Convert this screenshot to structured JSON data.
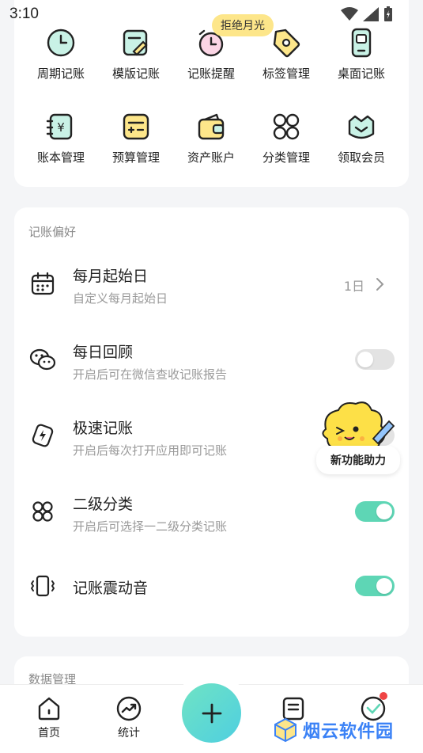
{
  "status": {
    "time": "3:10"
  },
  "tools": {
    "tip": "拒绝月光",
    "items": [
      {
        "label": "周期记账",
        "icon": "clock-icon"
      },
      {
        "label": "模版记账",
        "icon": "template-edit-icon"
      },
      {
        "label": "记账提醒",
        "icon": "alarm-clock-icon"
      },
      {
        "label": "标签管理",
        "icon": "tag-icon"
      },
      {
        "label": "桌面记账",
        "icon": "phone-widget-icon"
      },
      {
        "label": "账本管理",
        "icon": "ledger-icon"
      },
      {
        "label": "预算管理",
        "icon": "budget-calculator-icon"
      },
      {
        "label": "资产账户",
        "icon": "wallet-icon"
      },
      {
        "label": "分类管理",
        "icon": "category-grid-icon"
      },
      {
        "label": "领取会员",
        "icon": "vip-gem-icon"
      }
    ]
  },
  "prefs": {
    "title": "记账偏好",
    "rows": [
      {
        "title": "每月起始日",
        "subtitle": "自定义每月起始日",
        "value": "1日"
      },
      {
        "title": "每日回顾",
        "subtitle": "开启后可在微信查收记账报告",
        "toggle": false
      },
      {
        "title": "极速记账",
        "subtitle": "开启后每次打开应用即可记账",
        "toggle": false
      },
      {
        "title": "二级分类",
        "subtitle": "开启后可选择一二级分类记账",
        "toggle": true
      },
      {
        "title": "记账震动音",
        "toggle": true
      }
    ]
  },
  "mascot": {
    "label": "新功能助力"
  },
  "data_section": {
    "title": "数据管理"
  },
  "nav": {
    "home": "首页",
    "stats": "统计",
    "add": "+"
  },
  "watermark": {
    "text": "烟云软件园"
  },
  "colors": {
    "accent": "#5ed6b5",
    "tip": "#fde68a",
    "badge": "#ef4444"
  }
}
